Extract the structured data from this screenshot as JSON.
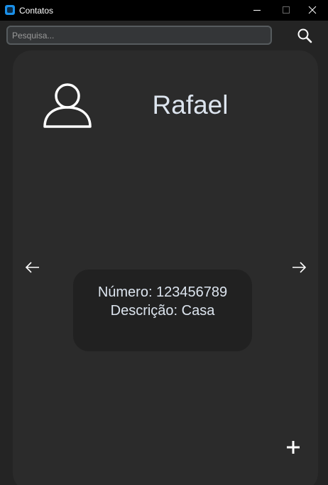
{
  "window": {
    "title": "Contatos"
  },
  "search": {
    "placeholder": "Pesquisa...",
    "value": ""
  },
  "contact": {
    "name": "Rafael",
    "number_line": "Número: 123456789",
    "description_line": "Descrição: Casa"
  },
  "icons": {
    "app": "app-icon",
    "search": "search-icon",
    "avatar": "person-icon",
    "previous": "arrow-left-icon",
    "next": "arrow-right-icon",
    "add": "plus-icon"
  },
  "colors": {
    "background": "#242424",
    "card": "#2b2b2b",
    "info_box": "#212121",
    "text": "#dce4ee",
    "titlebar": "#000000",
    "app_icon": "#1a8fe8"
  }
}
